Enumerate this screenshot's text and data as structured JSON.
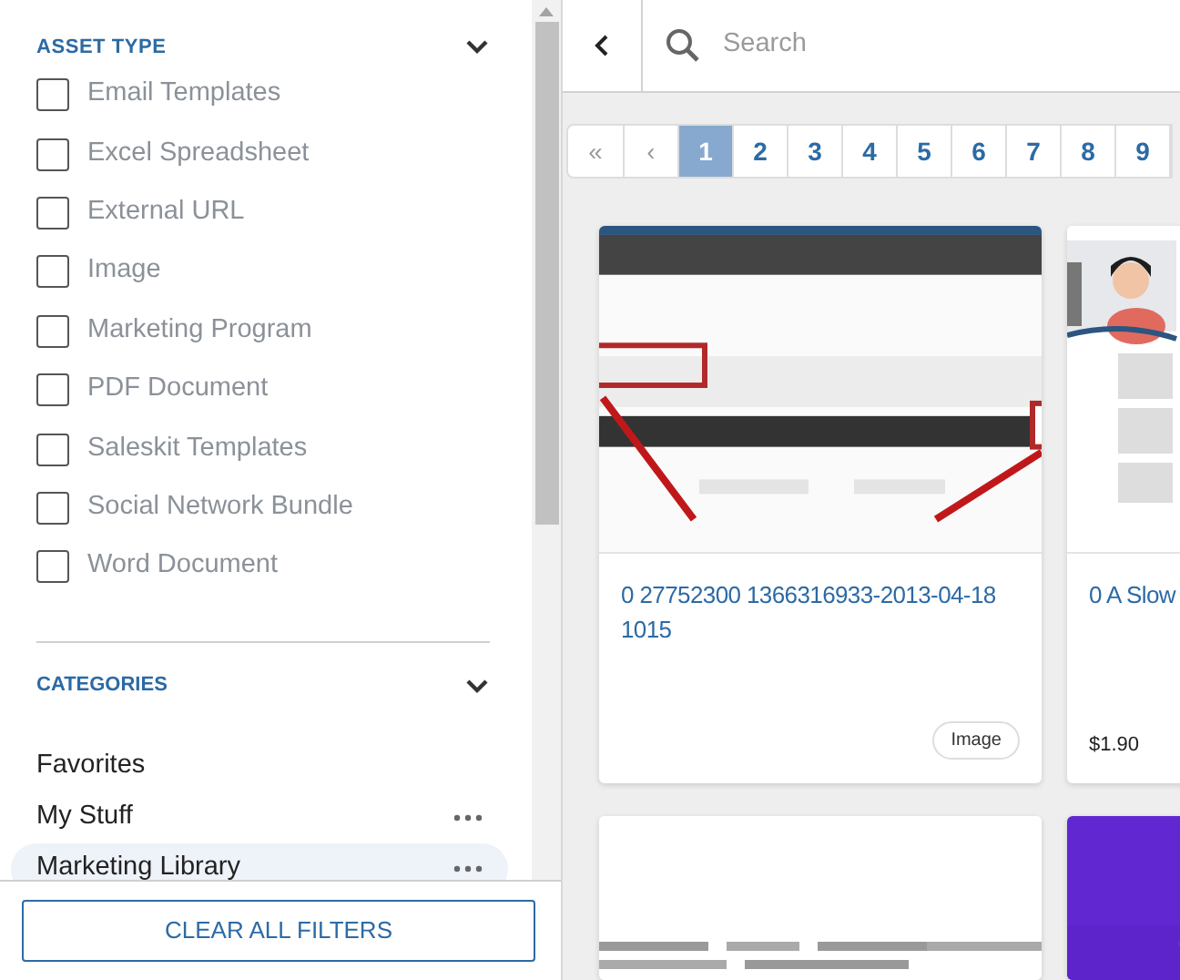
{
  "sidebar": {
    "asset_type": {
      "title": "ASSET TYPE",
      "expanded": true,
      "items": [
        {
          "label": "Email Templates",
          "checked": false
        },
        {
          "label": "Excel Spreadsheet",
          "checked": false
        },
        {
          "label": "External URL",
          "checked": false
        },
        {
          "label": "Image",
          "checked": false
        },
        {
          "label": "Marketing Program",
          "checked": false
        },
        {
          "label": "PDF Document",
          "checked": false
        },
        {
          "label": "Saleskit Templates",
          "checked": false
        },
        {
          "label": "Social Network Bundle",
          "checked": false
        },
        {
          "label": "Word Document",
          "checked": false
        }
      ]
    },
    "categories": {
      "title": "CATEGORIES",
      "expanded": true,
      "items": [
        {
          "label": "Favorites",
          "selected": false,
          "has_menu": false
        },
        {
          "label": "My Stuff",
          "selected": false,
          "has_menu": true
        },
        {
          "label": "Marketing Library",
          "selected": true,
          "has_menu": true
        }
      ]
    },
    "clear_button": "CLEAR ALL FILTERS"
  },
  "search": {
    "placeholder": "Search"
  },
  "pagination": {
    "first": "«",
    "prev": "‹",
    "pages": [
      {
        "label": "1",
        "selected": true
      },
      {
        "label": "2",
        "selected": false
      },
      {
        "label": "3",
        "selected": false
      },
      {
        "label": "4",
        "selected": false
      },
      {
        "label": "5",
        "selected": false
      },
      {
        "label": "6",
        "selected": false
      },
      {
        "label": "7",
        "selected": false
      },
      {
        "label": "8",
        "selected": false
      },
      {
        "label": "9",
        "selected": false
      }
    ]
  },
  "cards": [
    {
      "kind": "screenshot",
      "title": "0 27752300 1366316933-2013-04-18 1015",
      "badge": "Image"
    },
    {
      "title": "0 A Slow",
      "price": "$1.90"
    },
    {
      "kind": "code"
    },
    {
      "kind": "purple"
    }
  ]
}
